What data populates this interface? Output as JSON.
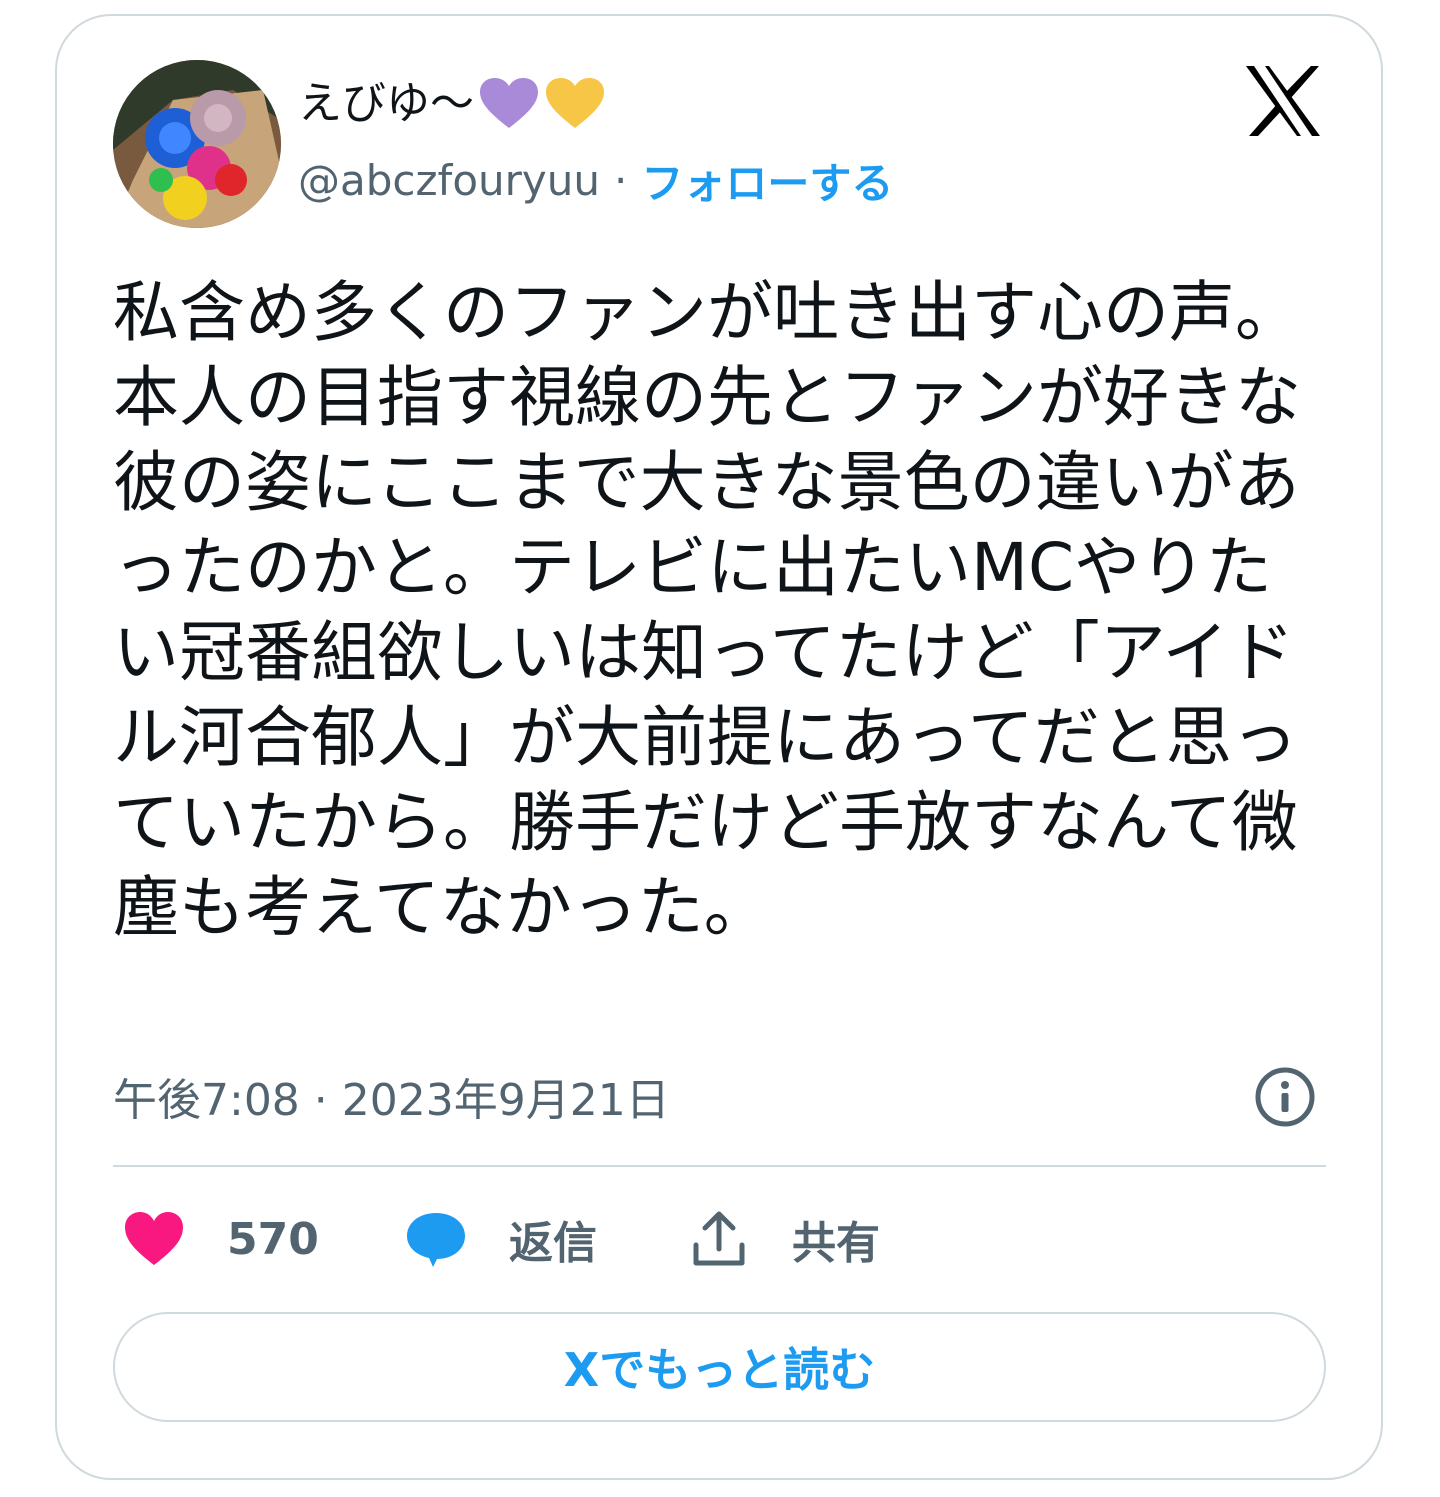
{
  "user": {
    "display_name": "えびゆ〜",
    "emoji": [
      "purple-heart",
      "yellow-heart"
    ],
    "handle": "@abczfouryuu",
    "separator": "·",
    "follow_label": "フォローする"
  },
  "tweet": {
    "text": "私含め多くのファンが吐き出す心の声。本人の目指す視線の先とファンが好きな彼の姿にここまで大きな景色の違いがあったのかと。テレビに出たいMCやりたい冠番組欲しいは知ってたけど「アイドル河合郁人」が大前提にあってだと思っていたから。勝手だけど手放すなんて微塵も考えてなかった。",
    "timestamp": "午後7:08 · 2023年9月21日"
  },
  "actions": {
    "like_count": "570",
    "reply_label": "返信",
    "share_label": "共有"
  },
  "read_more_label": "Xでもっと読む",
  "colors": {
    "accent": "#1d9bf0",
    "like": "#f91880",
    "text": "#0f1419",
    "secondary": "#536471",
    "border": "#cfd9de"
  }
}
